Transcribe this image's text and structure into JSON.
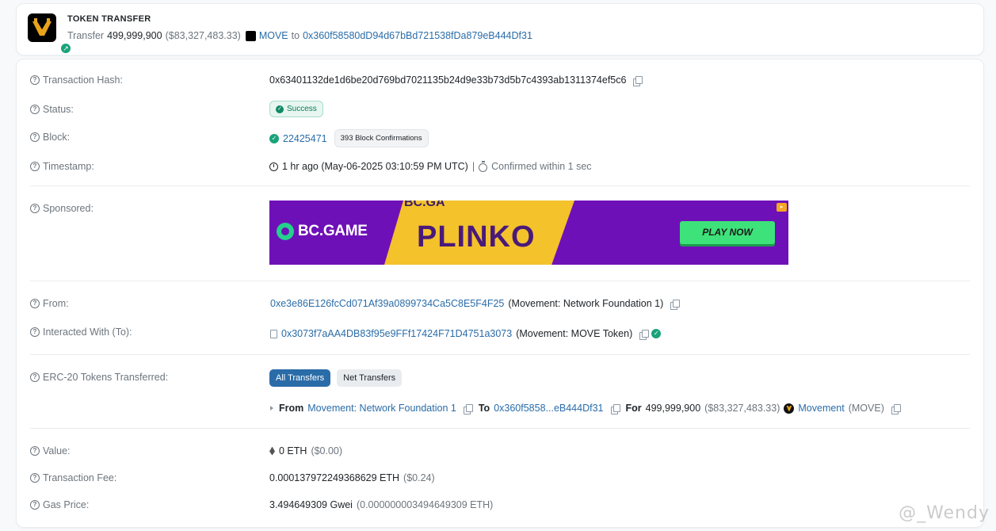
{
  "summary": {
    "title": "TOKEN TRANSFER",
    "transfer_word": "Transfer",
    "amount": "499,999,900",
    "usd": "($83,327,483.33)",
    "token": "MOVE",
    "to_word": "to",
    "to_address": "0x360f58580dD94d67bBd721538fDa879eB444Df31"
  },
  "fields": {
    "tx_hash_label": "Transaction Hash:",
    "tx_hash": "0x63401132de1d6be20d769bd7021135b24d9e33b73d5b7c4393ab1311374ef5c6",
    "status_label": "Status:",
    "status": "Success",
    "block_label": "Block:",
    "block": "22425471",
    "confirmations": "393 Block Confirmations",
    "timestamp_label": "Timestamp:",
    "timestamp": "1 hr ago (May-06-2025 03:10:59 PM UTC)",
    "separator": "|",
    "confirmed": "Confirmed within 1 sec",
    "sponsored_label": "Sponsored:",
    "from_label": "From:",
    "from_address": "0xe3e86E126fcCd071Af39a0899734Ca5C8E5F4F25",
    "from_name": "(Movement: Network Foundation 1)",
    "to_label": "Interacted With (To):",
    "to_address": "0x3073f7aAA4DB83f95e9FFf17424F71D4751a3073",
    "to_name": "(Movement: MOVE Token)",
    "erc20_label": "ERC-20 Tokens Transferred:",
    "value_label": "Value:",
    "value": "0 ETH",
    "value_usd": "($0.00)",
    "fee_label": "Transaction Fee:",
    "fee": "0.000137972249368629 ETH",
    "fee_usd": "($0.24)",
    "gas_label": "Gas Price:",
    "gas": "3.494649309 Gwei",
    "gas_eth": "(0.000000003494649309 ETH)"
  },
  "banner": {
    "brand": "BC.GAME",
    "game": "PLINKO",
    "cta": "PLAY NOW",
    "top_text": "BC.GA"
  },
  "erc20": {
    "tab_all": "All Transfers",
    "tab_net": "Net Transfers",
    "from_word": "From",
    "from_name": "Movement: Network Foundation 1",
    "to_word": "To",
    "to_address": "0x360f5858...eB444Df31",
    "for_word": "For",
    "amount": "499,999,900",
    "usd": "($83,327,483.33)",
    "token_name": "Movement",
    "token_symbol": "(MOVE)"
  },
  "watermark": "@_Wendy",
  "colors": {
    "link": "#2a6ca8",
    "success": "#0f8a64",
    "banner_purple": "#6e10b8",
    "banner_yellow": "#f4c22b"
  }
}
